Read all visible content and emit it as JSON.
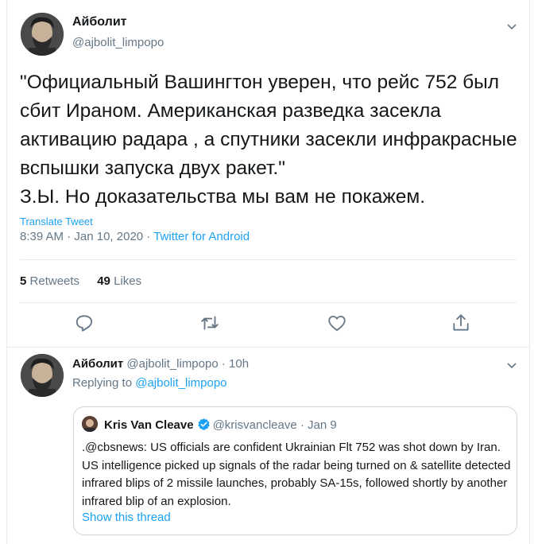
{
  "main_tweet": {
    "author_name": "Айболит",
    "author_handle": "@ajbolit_limpopo",
    "text": "\"Официальный Вашингтон уверен, что рейс 752 был сбит Ираном. Американская разведка засекла активацию радара , а спутники засекли инфракрасные вспышки запуска двух ракет.\"\nЗ.Ы. Но доказательства мы вам не покажем.",
    "translate_label": "Translate Tweet",
    "time": "8:39 AM",
    "date": "Jan 10, 2020",
    "source": "Twitter for Android",
    "retweets_count": "5",
    "retweets_label": "Retweets",
    "likes_count": "49",
    "likes_label": "Likes"
  },
  "reply_tweet": {
    "author_name": "Айболит",
    "author_handle": "@ajbolit_limpopo",
    "age": "10h",
    "replying_prefix": "Replying to",
    "replying_to": "@ajbolit_limpopo",
    "quoted": {
      "author_name": "Kris Van Cleave",
      "author_handle": "@krisvancleave",
      "date": "Jan 9",
      "text": ".@cbsnews: US officials are confident Ukrainian Flt 752 was shot down by Iran. US intelligence picked up signals of the radar being turned on & satellite detected infrared blips of 2 missile launches, probably SA-15s, followed shortly by another infrared blip of an explosion.",
      "show_thread": "Show this thread"
    }
  },
  "icons": [
    "chevron-down-icon",
    "reply-icon",
    "retweet-icon",
    "like-icon",
    "share-icon",
    "verified-icon"
  ],
  "colors": {
    "accent": "#1da1f2",
    "secondary_text": "#657786",
    "primary_text": "#14171a",
    "border": "#e6ecf0"
  }
}
